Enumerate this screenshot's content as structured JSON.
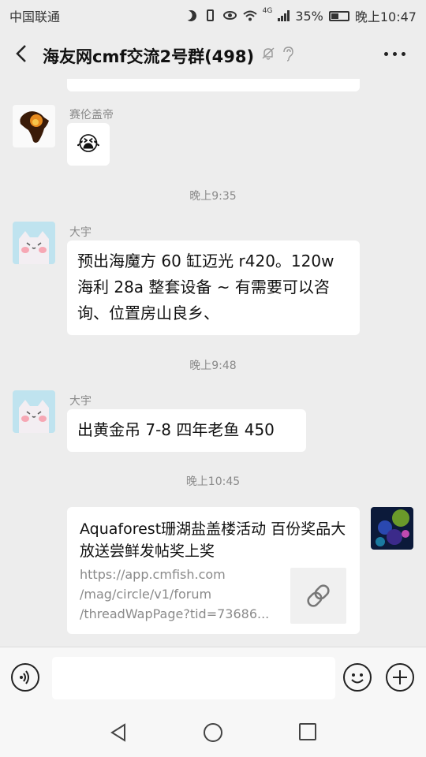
{
  "status_bar": {
    "carrier": "中国联通",
    "network": "4G",
    "battery": "35%",
    "time": "晚上10:47"
  },
  "header": {
    "back_icon": "chevron-left-icon",
    "title": "海友网cmf交流2号群(498)",
    "more_icon": "more-dots-icon"
  },
  "messages": [
    {
      "sender": "赛伦盖帝",
      "content": "😭"
    },
    {
      "timestamp": "晚上9:35"
    },
    {
      "sender": "大宇",
      "content": [
        "预出海魔方 60 缸迈光 r420。120w",
        "海利 28a 整套设备 ~ 有需要可以咨",
        "询、位置房山良乡、"
      ]
    },
    {
      "timestamp": "晚上9:48"
    },
    {
      "sender": "大宇",
      "content": "出黄金吊 7-8   四年老鱼 450"
    },
    {
      "timestamp": "晚上10:45"
    },
    {
      "link": {
        "title": "Aquaforest珊湖盐盖楼活动 百份奖品大放送尝鲜发帖奖上奖",
        "url_lines": [
          "https://app.cmfish.com",
          "/mag/circle/v1/forum",
          "/threadWapPage?tid=73686..."
        ]
      }
    }
  ],
  "input_bar": {
    "message_value": "",
    "voice_icon": "voice-icon",
    "emoji_icon": "emoji-icon",
    "plus_icon": "plus-icon"
  },
  "nav_bar": {
    "back_icon": "triangle-back-icon",
    "home_icon": "circle-home-icon",
    "recent_icon": "square-recent-icon"
  }
}
